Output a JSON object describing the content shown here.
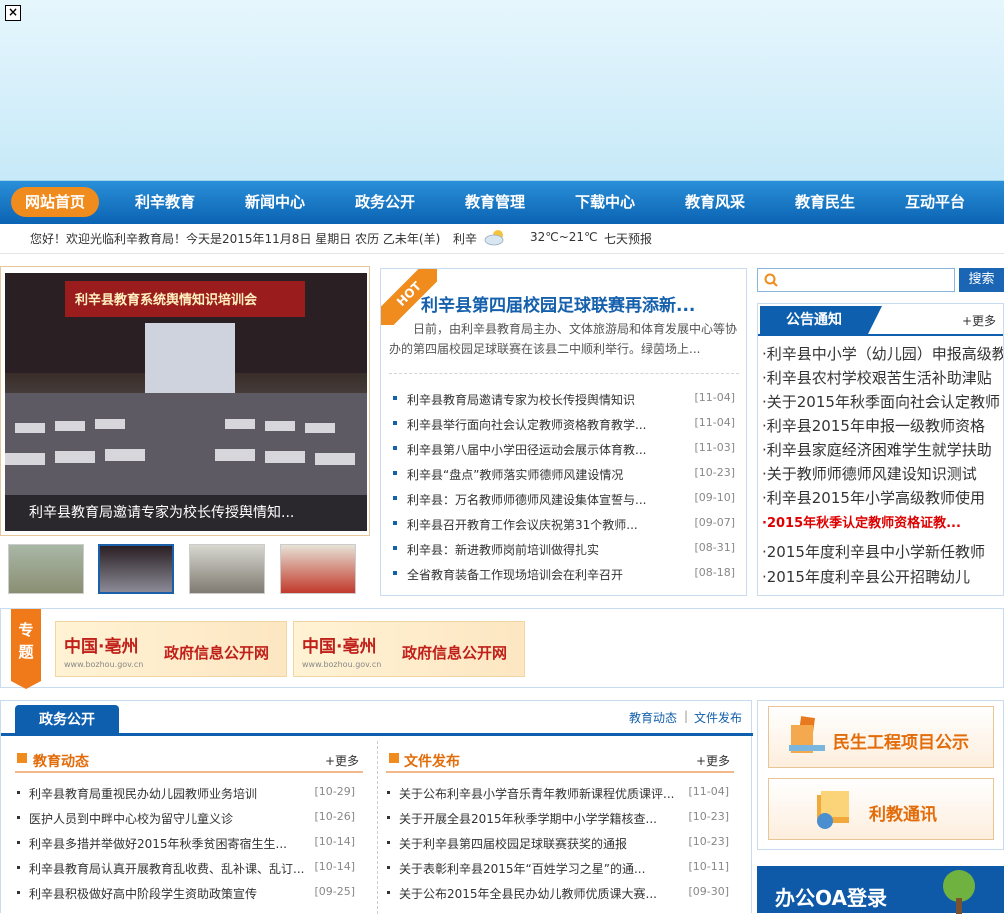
{
  "banner": {
    "close_glyph": "×"
  },
  "nav": {
    "items": [
      "网站首页",
      "利辛教育",
      "新闻中心",
      "政务公开",
      "教育管理",
      "下载中心",
      "教育风采",
      "教育民生",
      "互动平台"
    ]
  },
  "infobar": {
    "welcome": "您好！欢迎光临利辛教育局！今天是2015年11月8日  星期日  农历  乙未年(羊)",
    "city": "利辛",
    "temp": "32℃~21℃",
    "forecast": "七天预报"
  },
  "slideshow": {
    "caption": "利辛县教育局邀请专家为校长传授舆情知...",
    "banner_text": "利辛县教育系统舆情知识培训会"
  },
  "news": {
    "hot_badge": "HOT",
    "hot_title": "利辛县第四届校园足球联赛再添新...",
    "hot_summary": "日前，由利辛县教育局主办、文体旅游局和体育发展中心等协办的第四届校园足球联赛在该县二中顺利举行。绿茵场上...",
    "items": [
      {
        "title": "利辛县教育局邀请专家为校长传授舆情知识",
        "date": "[11-04]"
      },
      {
        "title": "利辛县举行面向社会认定教师资格教育教学...",
        "date": "[11-04]"
      },
      {
        "title": "利辛县第八届中小学田径运动会展示体育教...",
        "date": "[11-03]"
      },
      {
        "title": "利辛县“盘点”教师落实师德师风建设情况",
        "date": "[10-23]"
      },
      {
        "title": "利辛县：万名教师师德师风建设集体宣誓与...",
        "date": "[09-10]"
      },
      {
        "title": "利辛县召开教育工作会议庆祝第31个教师...",
        "date": "[09-07]"
      },
      {
        "title": "利辛县：新进教师岗前培训做得扎实",
        "date": "[08-31]"
      },
      {
        "title": "全省教育装备工作现场培训会在利辛召开",
        "date": "[08-18]"
      }
    ]
  },
  "search": {
    "placeholder": "",
    "button": "搜索"
  },
  "notice": {
    "tab": "公告通知",
    "more": "+更多",
    "items": [
      "·利辛县中小学（幼儿园）申报高级教师",
      "·利辛县农村学校艰苦生活补助津贴",
      "·关于2015年秋季面向社会认定教师",
      "·利辛县2015年申报一级教师资格",
      "·利辛县家庭经济困难学生就学扶助",
      "·关于教师师德师风建设知识测试",
      "·利辛县2015年小学高级教师使用",
      "·2015年秋季认定教师资格证教...",
      "·2015年度利辛县中小学新任教师",
      "·2015年度利辛县公开招聘幼儿"
    ]
  },
  "special": {
    "tag_1": "专",
    "tag_2": "题",
    "banners": [
      {
        "a": "中国·亳州",
        "b": "政府信息公开网",
        "c": "www.bozhou.gov.cn"
      },
      {
        "a": "中国·亳州",
        "b": "政府信息公开网",
        "c": "www.bozhou.gov.cn"
      }
    ]
  },
  "zhengwu": {
    "tab": "政务公开",
    "link_1": "教育动态",
    "sep": "|",
    "link_2": "文件发布",
    "left": {
      "title": "教育动态",
      "more": "+更多",
      "items": [
        {
          "title": "利辛县教育局重视民办幼儿园教师业务培训",
          "date": "[10-29]"
        },
        {
          "title": "医护人员到中畔中心校为留守儿童义诊",
          "date": "[10-26]"
        },
        {
          "title": "利辛县多措并举做好2015年秋季贫困寄宿生生...",
          "date": "[10-14]"
        },
        {
          "title": "利辛县教育局认真开展教育乱收费、乱补课、乱订...",
          "date": "[10-14]"
        },
        {
          "title": "利辛县积极做好高中阶段学生资助政策宣传",
          "date": "[09-25]"
        }
      ]
    },
    "right": {
      "title": "文件发布",
      "more": "+更多",
      "items": [
        {
          "title": "关于公布利辛县小学音乐青年教师新课程优质课评...",
          "date": "[11-04]"
        },
        {
          "title": "关于开展全县2015年秋季学期中小学学籍核查...",
          "date": "[10-23]"
        },
        {
          "title": "关于利辛县第四届校园足球联赛获奖的通报",
          "date": "[10-23]"
        },
        {
          "title": "关于表彰利辛县2015年“百姓学习之星”的通...",
          "date": "[10-11]"
        },
        {
          "title": "关于公布2015年全县民办幼儿教师优质课大赛...",
          "date": "[09-30]"
        }
      ]
    }
  },
  "side": {
    "minsheng": "民生工程项目公示",
    "lijiao": "利教通讯",
    "oa": "办公OA登录"
  }
}
